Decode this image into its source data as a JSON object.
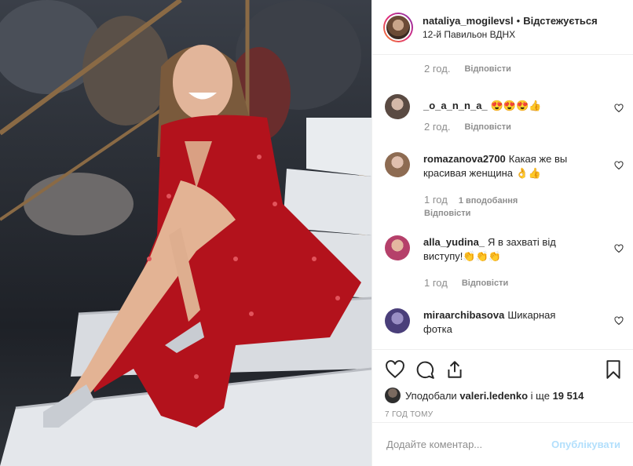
{
  "post": {
    "username": "nataliya_mogilevsl",
    "follow_status": "Відстежується",
    "location": "12-й Павильон ВДНХ"
  },
  "comments": [
    {
      "time": "2 год.",
      "reply": "Відповісти"
    },
    {
      "user": "_o_a_n_n_a_",
      "text": "😍😍😍👍",
      "time": "2 год.",
      "reply": "Відповісти"
    },
    {
      "user": "romazanova2700",
      "text": "Какая же вы красивая женщина 👌👍",
      "time": "1 год",
      "likes": "1 вподобання",
      "reply": "Відповісти"
    },
    {
      "user": "alla_yudina_",
      "text": "Я в захваті від виступу!👏👏👏",
      "time": "1 год",
      "reply": "Відповісти"
    },
    {
      "user": "miraarchibasova",
      "text": "Шикарная фотка"
    }
  ],
  "actions": {
    "liked_by_prefix": "Уподобали",
    "liked_by_user": "valeri.ledenko",
    "liked_by_more_prefix": "і ще",
    "liked_by_count": "19 514",
    "posted_ago": "7 ГОД ТОМУ"
  },
  "composer": {
    "placeholder": "Додайте коментар...",
    "publish_label": "Опублікувати"
  },
  "icons": [
    "heart-icon",
    "comment-icon",
    "share-icon",
    "bookmark-icon"
  ]
}
